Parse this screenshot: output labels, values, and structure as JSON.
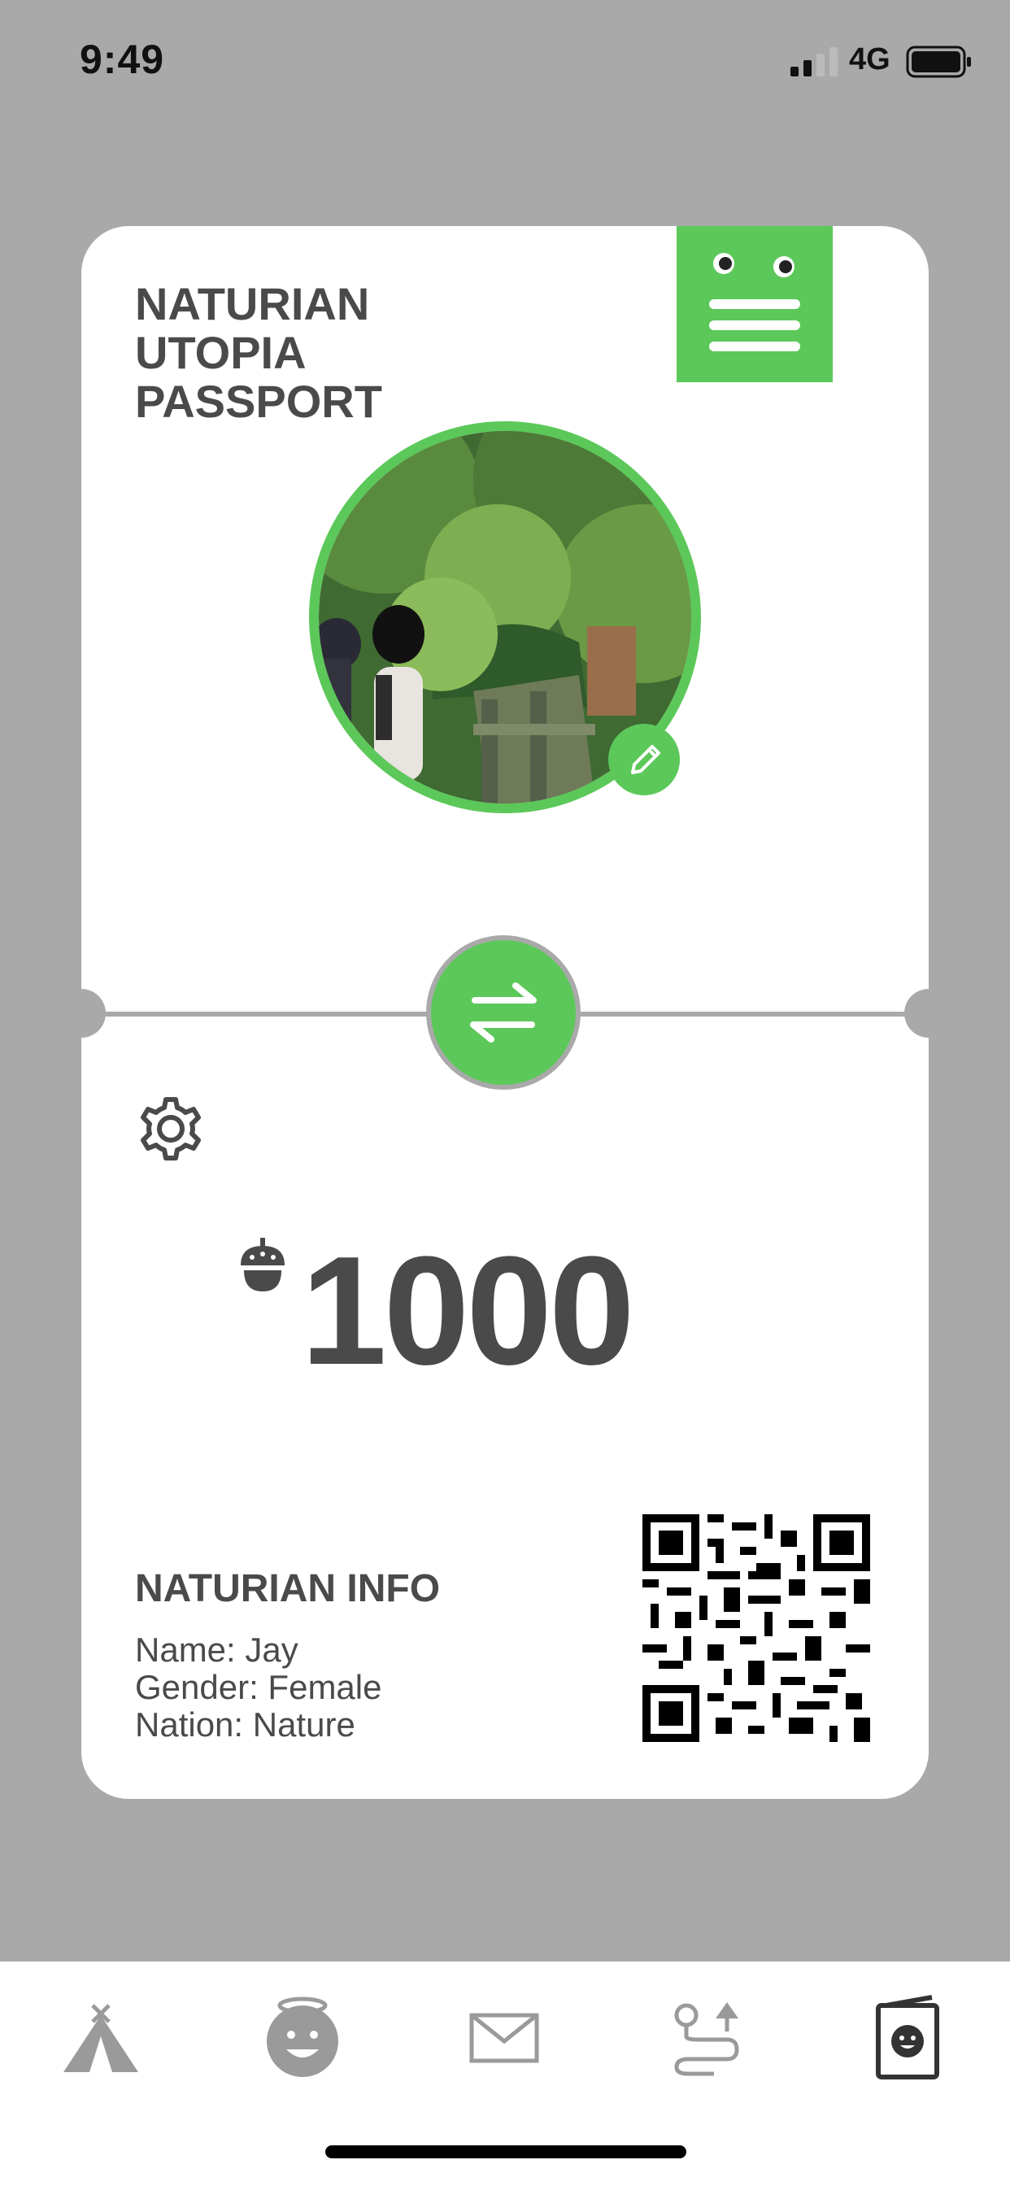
{
  "status_bar": {
    "time": "9:49",
    "network": "4G"
  },
  "card": {
    "title_lines": [
      "NATURIAN",
      "UTOPIA",
      "PASSPORT"
    ],
    "balance": "1000",
    "info": {
      "title": "NATURIAN INFO",
      "name": "Name: Jay",
      "gender": "Gender: Female",
      "nation": "Nation: Nature"
    }
  },
  "icons": {
    "menu": "hamburger-menu-icon",
    "avatar_edit": "pencil-icon",
    "swap": "swap-arrows-icon",
    "settings": "gear-icon",
    "currency": "acorn-icon"
  },
  "tabs": [
    {
      "name": "tent-icon"
    },
    {
      "name": "angel-face-icon"
    },
    {
      "name": "mail-icon"
    },
    {
      "name": "route-icon"
    },
    {
      "name": "passport-icon"
    }
  ],
  "colors": {
    "accent": "#5cc85a",
    "background": "#a9a9a9",
    "text": "#4a4a4a"
  }
}
